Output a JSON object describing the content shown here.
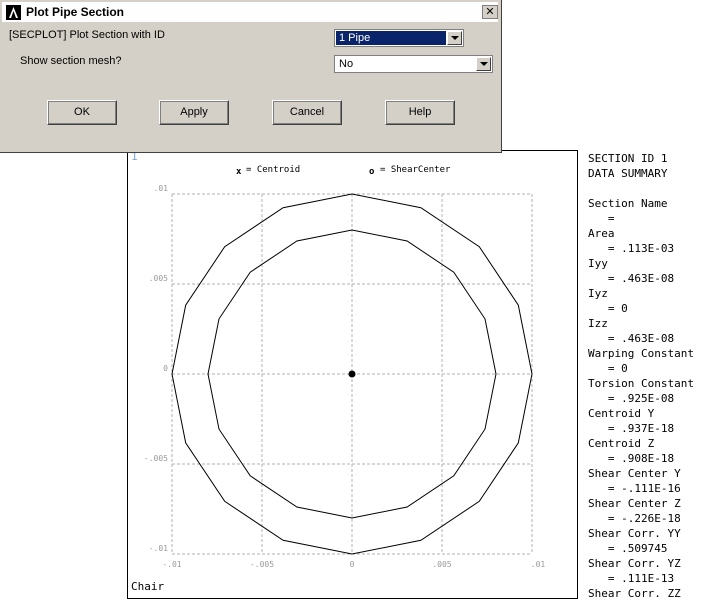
{
  "dialog": {
    "title": "Plot Pipe Section",
    "close_glyph": "☒",
    "section_id_label": "[SECPLOT] Plot Section with ID",
    "section_id_value": "1  Pipe",
    "mesh_label": "Show section mesh?",
    "mesh_value": "No",
    "buttons": {
      "ok": "OK",
      "apply": "Apply",
      "cancel": "Cancel",
      "help": "Help"
    }
  },
  "plot": {
    "window_number": "1",
    "legend": {
      "centroid_symbol": "x",
      "centroid_text": "= Centroid",
      "shear_symbol": "o",
      "shear_text": "= ShearCenter"
    },
    "y_ticks": [
      ".01",
      ".005",
      "0",
      "-.005",
      "-.01"
    ],
    "x_ticks": [
      "-.01",
      "-.005",
      "0",
      ".005",
      ".01"
    ],
    "outer_radius": 0.01,
    "inner_radius": 0.008,
    "segments": 16,
    "footer": "Chair"
  },
  "summary": {
    "lines": [
      "SECTION ID 1",
      "DATA SUMMARY",
      "",
      "Section Name",
      "   =",
      "Area",
      "   = .113E-03",
      "Iyy",
      "   = .463E-08",
      "Iyz",
      "   = 0",
      "Izz",
      "   = .463E-08",
      "Warping Constant",
      "   = 0",
      "Torsion Constant",
      "   = .925E-08",
      "Centroid Y",
      "   = .937E-18",
      "Centroid Z",
      "   = .908E-18",
      "Shear Center Y",
      "   = -.111E-16",
      "Shear Center Z",
      "   = -.226E-18",
      "Shear Corr. YY",
      "   = .509745",
      "Shear Corr. YZ",
      "   = .111E-13",
      "Shear Corr. ZZ"
    ]
  }
}
